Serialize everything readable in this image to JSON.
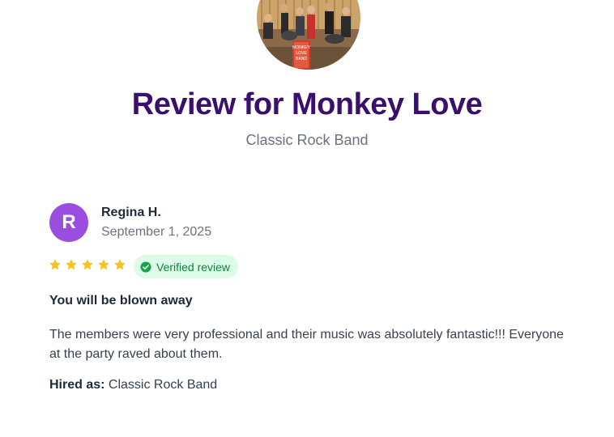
{
  "header": {
    "title": "Review for Monkey Love",
    "subtitle": "Classic Rock Band"
  },
  "band_photo": {
    "sign_lines": [
      "MONKEY",
      "LOVE",
      "BAND"
    ]
  },
  "review": {
    "avatar_initial": "R",
    "reviewer_name": "Regina H.",
    "date": "September 1, 2025",
    "rating": 5,
    "rating_max": 5,
    "verified_label": "Verified review",
    "title": "You will be blown away",
    "body": "The members were very professional and their music was absolutely fantastic!!! Everyone at the party raved about them.",
    "hired_as_label": "Hired as:",
    "hired_as_value": "Classic Rock Band"
  },
  "colors": {
    "title": "#3b0f6e",
    "avatar": "#9b4de0",
    "star": "#f5c518",
    "verified_bg": "#dcfce7",
    "verified_text": "#15803d"
  },
  "icons": {
    "star": "star-icon",
    "verified": "check-circle-icon"
  }
}
